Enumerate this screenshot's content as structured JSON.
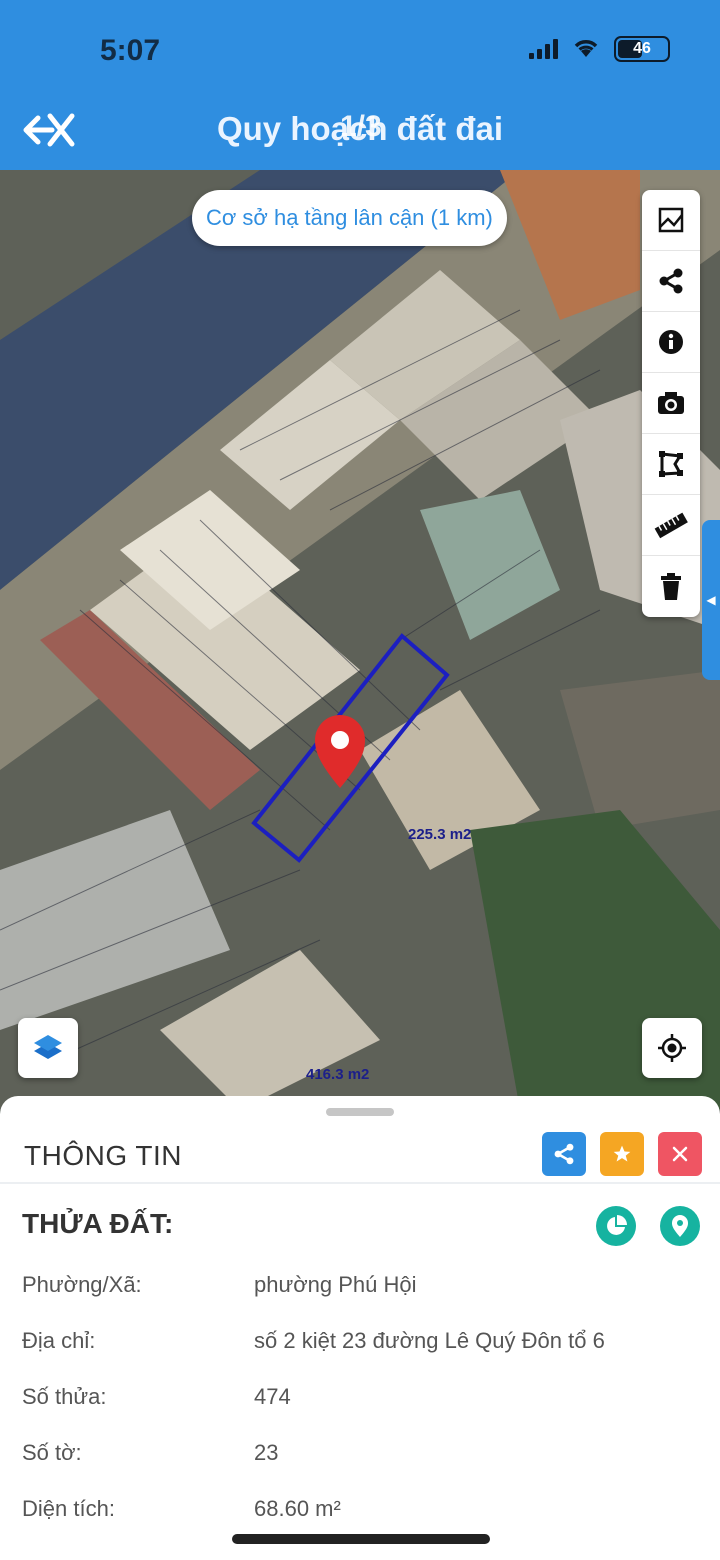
{
  "status_bar": {
    "time": "5:07",
    "battery": "46"
  },
  "header": {
    "title": "Quy hoạch đất đai",
    "counter": "1/3"
  },
  "map": {
    "chip_label": "Cơ sở hạ tầng lân cận (1 km)",
    "area_labels": [
      "225.3 m2",
      "416.3 m2"
    ],
    "tools": [
      "image-icon",
      "share-icon",
      "info-icon",
      "camera-icon",
      "polygon-icon",
      "ruler-icon",
      "trash-icon"
    ]
  },
  "sheet": {
    "title": "THÔNG TIN",
    "parcel_title": "THỬA ĐẤT:",
    "rows": [
      {
        "label": "Phường/Xã:",
        "value": "phường Phú Hội"
      },
      {
        "label": "Địa chỉ:",
        "value": "số 2 kiệt 23 đường Lê Quý Đôn tổ 6"
      },
      {
        "label": "Số thửa:",
        "value": "474"
      },
      {
        "label": "Số tờ:",
        "value": "23"
      },
      {
        "label": "Diện tích:",
        "value": "68.60 m²"
      }
    ]
  },
  "colors": {
    "primary": "#2f8ee0",
    "star": "#f5a623",
    "close": "#ef5563",
    "teal": "#16b3a0",
    "parcel_outline": "#1c1fc0",
    "pin": "#e02b2b"
  }
}
